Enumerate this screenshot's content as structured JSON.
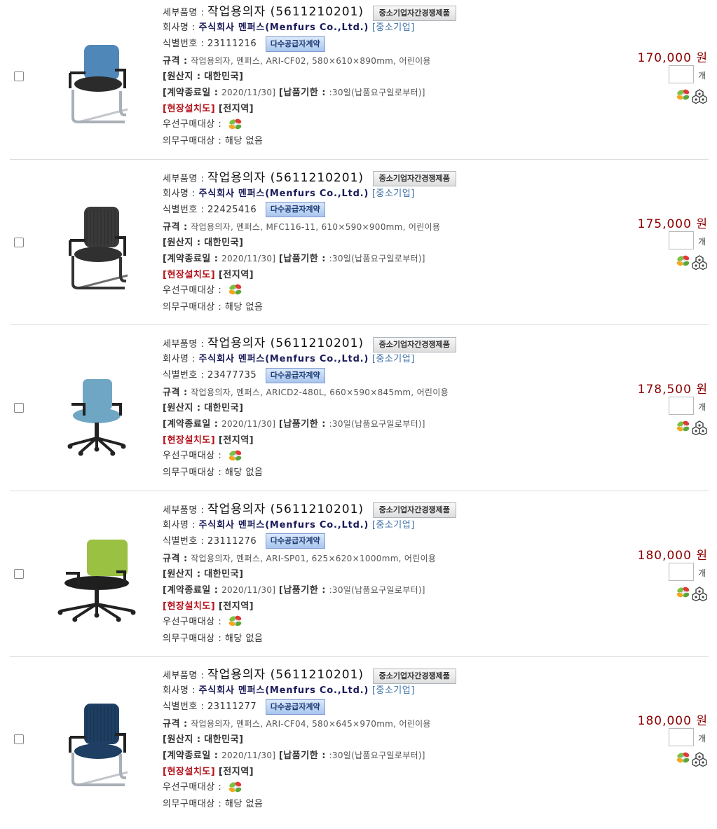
{
  "labels": {
    "detail_name": "세부품명 :",
    "company": "회사명 :",
    "id": "식별번호 :",
    "spec": "규격 :",
    "origin": "[원산지 :",
    "contract_end": "[계약종료일 :",
    "delivery": "[납품기한 :",
    "install": "[현장설치도]",
    "priority": "우선구매대상 :",
    "mandatory": "의무구매대상 :",
    "unit": "개",
    "currency": "원"
  },
  "items": [
    {
      "product": "작업용의자 (5611210201)",
      "smb_badge": "중소기업자간경쟁제품",
      "company_name": "주식회사 멘퍼스(Menfurs Co.,Ltd.)",
      "company_type": "[중소기업]",
      "id_number": "23111216",
      "contract_badge": "다수공급자계약",
      "spec": "작업용의자, 멘퍼스, ARI-CF02, 580×610×890mm, 어린이용",
      "origin": "대한민국]",
      "contract_end": "2020/11/30]",
      "delivery": ":30일(납품요구일로부터)]",
      "install": "[전지역]",
      "mandatory": "해당 없음",
      "price": "170,000",
      "qty": "",
      "chair": {
        "style": "sled",
        "color": "#4f87b8",
        "seat": "#2b2b2b"
      }
    },
    {
      "product": "작업용의자 (5611210201)",
      "smb_badge": "중소기업자간경쟁제품",
      "company_name": "주식회사 멘퍼스(Menfurs Co.,Ltd.)",
      "company_type": "[중소기업]",
      "id_number": "22425416",
      "contract_badge": "다수공급자계약",
      "spec": "작업용의자, 멘퍼스, MFC116-11, 610×590×900mm, 어린이용",
      "origin": "대한민국]",
      "contract_end": "2020/11/30]",
      "delivery": ":30일(납품요구일로부터)]",
      "install": "[전지역]",
      "mandatory": "해당 없음",
      "price": "175,000",
      "qty": "",
      "chair": {
        "style": "sled-dark",
        "color": "#3a3a3a",
        "seat": "#303030"
      }
    },
    {
      "product": "작업용의자 (5611210201)",
      "smb_badge": "중소기업자간경쟁제품",
      "company_name": "주식회사 멘퍼스(Menfurs Co.,Ltd.)",
      "company_type": "[중소기업]",
      "id_number": "23477735",
      "contract_badge": "다수공급자계약",
      "spec": "작업용의자, 멘퍼스, ARICD2-480L, 660×590×845mm, 어린이용",
      "origin": "대한민국]",
      "contract_end": "2020/11/30]",
      "delivery": ":30일(납품요구일로부터)]",
      "install": "[전지역]",
      "mandatory": "해당 없음",
      "price": "178,500",
      "qty": "",
      "chair": {
        "style": "swivel",
        "color": "#6ea6c4",
        "seat": "#6ea6c4"
      }
    },
    {
      "product": "작업용의자 (5611210201)",
      "smb_badge": "중소기업자간경쟁제품",
      "company_name": "주식회사 멘퍼스(Menfurs Co.,Ltd.)",
      "company_type": "[중소기업]",
      "id_number": "23111276",
      "contract_badge": "다수공급자계약",
      "spec": "작업용의자, 멘퍼스, ARI-SP01, 625×620×1000mm, 어린이용",
      "origin": "대한민국]",
      "contract_end": "2020/11/30]",
      "delivery": ":30일(납품요구일로부터)]",
      "install": "[전지역]",
      "mandatory": "해당 없음",
      "price": "180,000",
      "qty": "",
      "chair": {
        "style": "swivel-wide",
        "color": "#9bc043",
        "seat": "#1f1f1f"
      }
    },
    {
      "product": "작업용의자 (5611210201)",
      "smb_badge": "중소기업자간경쟁제품",
      "company_name": "주식회사 멘퍼스(Menfurs Co.,Ltd.)",
      "company_type": "[중소기업]",
      "id_number": "23111277",
      "contract_badge": "다수공급자계약",
      "spec": "작업용의자, 멘퍼스, ARI-CF04, 580×645×970mm, 어린이용",
      "origin": "대한민국]",
      "contract_end": "2020/11/30]",
      "delivery": ":30일(납품요구일로부터)]",
      "install": "[전지역]",
      "mandatory": "해당 없음",
      "price": "180,000",
      "qty": "",
      "chair": {
        "style": "sled-mesh",
        "color": "#1e3f63",
        "seat": "#1e3f63"
      }
    }
  ],
  "icons": {
    "priority_icon": "green-product-icon",
    "row_icons": [
      "green-product-icon",
      "compare-icon"
    ]
  },
  "colors": {
    "price": "#8b0000",
    "install_label": "#b5121b",
    "company": "#1a1a5a",
    "contract_badge": "#a9c6ee"
  }
}
